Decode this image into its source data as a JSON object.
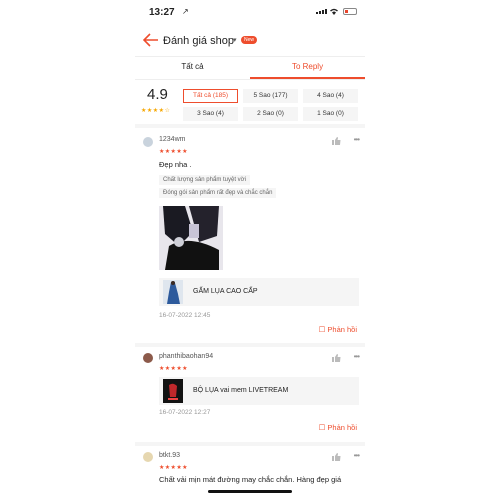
{
  "status_bar": {
    "time": "13:27",
    "location_glyph": "↗"
  },
  "header": {
    "title": "Đánh giá shop",
    "caret": "▾",
    "badge": "New"
  },
  "tabs": [
    {
      "label": "Tất cả",
      "active": false
    },
    {
      "label": "To Reply",
      "active": true
    }
  ],
  "summary": {
    "rating": "4.9",
    "stars": "★★★★☆",
    "filters": [
      "Tất cả (185)",
      "5 Sao (177)",
      "4 Sao (4)",
      "3 Sao (4)",
      "2 Sao (0)",
      "1 Sao (0)"
    ]
  },
  "reviews": [
    {
      "user": "1234wm",
      "stars": "★★★★★",
      "text": "Đẹp nha .",
      "tags": [
        "Chất lượng sản phẩm tuyệt vời",
        "Đóng gói sản phẩm rất đẹp và chắc chắn"
      ],
      "product": "GẤM LỤA CAO CẤP",
      "date": "16-07-2022 12:45",
      "reply": "Phản hồi"
    },
    {
      "user": "phanthibaohan94",
      "stars": "★★★★★",
      "product": "BỘ LỤA vai mem LIVETREAM",
      "date": "16-07-2022 12:27",
      "reply": "Phản hồi"
    },
    {
      "user": "btkt.93",
      "stars": "★★★★★",
      "text": "Chất vải mịn mát đường may chắc chắn. Hàng đẹp giá"
    }
  ],
  "more_glyph": "•••",
  "reply_glyph": "☐",
  "colors": {
    "accent": "#ee4d2d",
    "star": "#f6a700"
  }
}
